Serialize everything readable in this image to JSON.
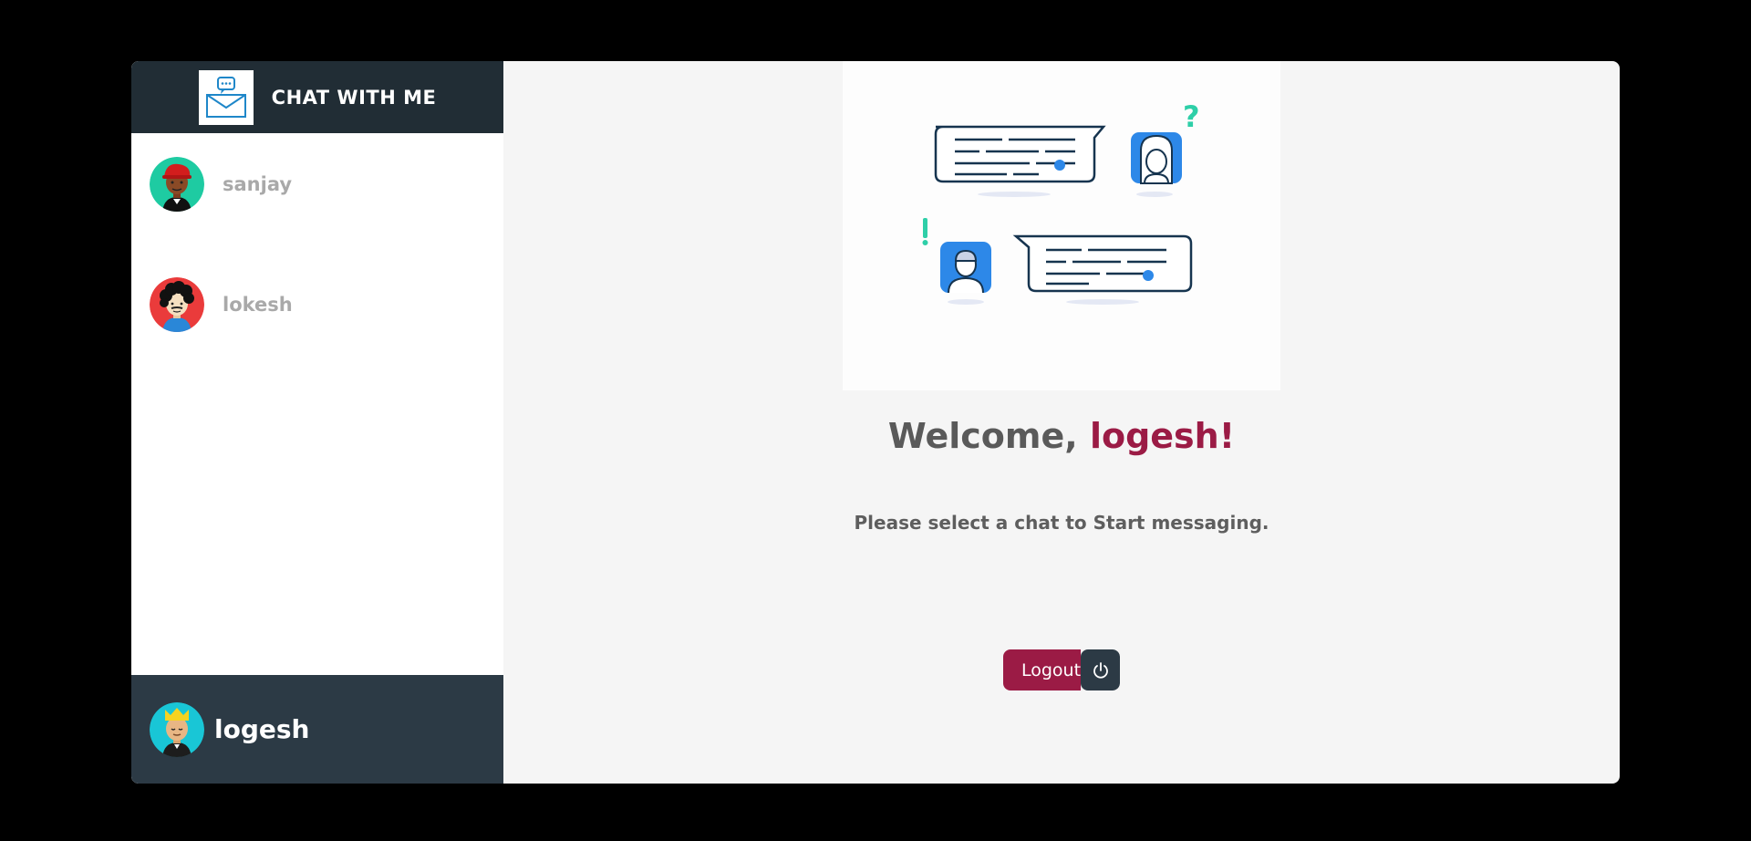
{
  "app": {
    "title": "CHAT WITH ME"
  },
  "contacts": [
    {
      "name": "sanjay",
      "icon": "avatar-red-cap-icon"
    },
    {
      "name": "lokesh",
      "icon": "avatar-curly-hair-icon"
    }
  ],
  "current_user": {
    "name": "logesh",
    "icon": "avatar-crown-icon"
  },
  "main": {
    "welcome_prefix": "Welcome, ",
    "welcome_user": "logesh!",
    "prompt": "Please select a chat to Start messaging.",
    "logout_label": "Logout",
    "logout_icon": "power-icon"
  },
  "colors": {
    "accent": "#9b1b45",
    "header": "#212d35",
    "footer": "#2c3a45",
    "illustration_blue": "#2d88e8",
    "illustration_teal": "#2ecfa8"
  }
}
